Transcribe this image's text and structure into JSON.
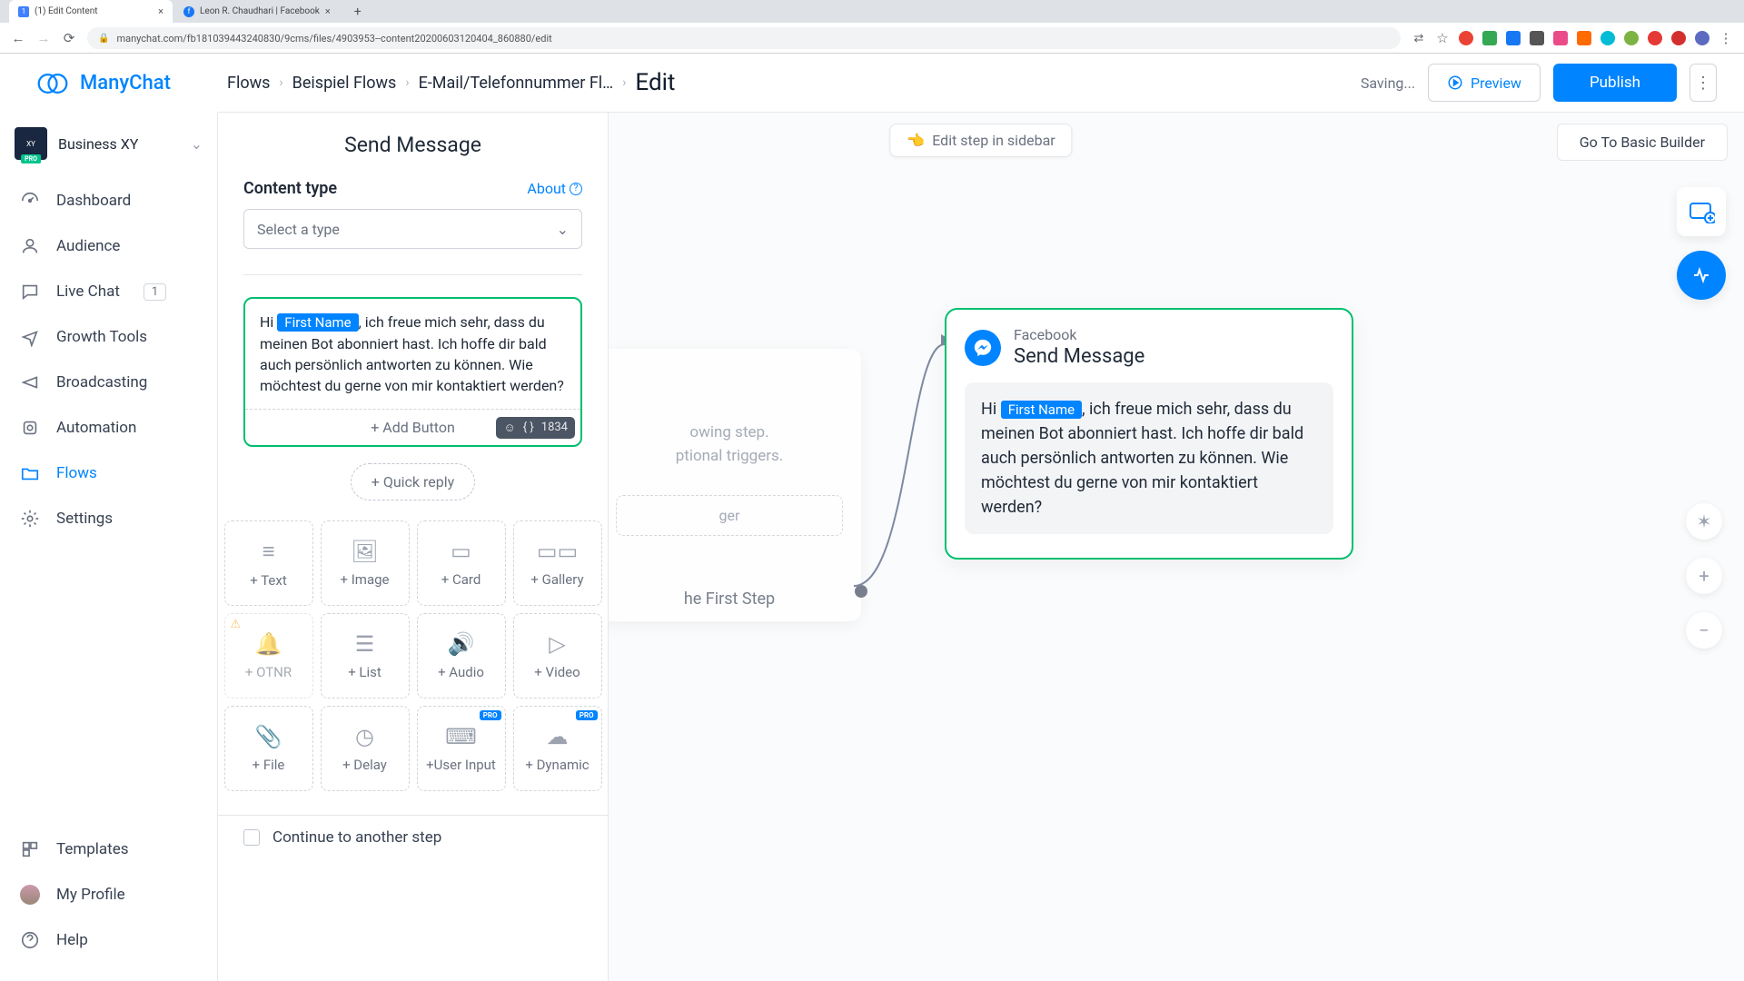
{
  "browser": {
    "tabs": [
      {
        "title": "(1) Edit Content",
        "fav": "1"
      },
      {
        "title": "Leon R. Chaudhari | Facebook",
        "fav": "f"
      }
    ],
    "url": "manychat.com/fb181039443240830/9cms/files/4903953--content20200603120404_860880/edit"
  },
  "app": {
    "logo_text": "ManyChat",
    "breadcrumbs": [
      "Flows",
      "Beispiel Flows",
      "E-Mail/Telefonnummer Fl…",
      "Edit"
    ],
    "saving": "Saving...",
    "preview": "Preview",
    "publish": "Publish"
  },
  "biz": {
    "name": "Business XY",
    "pro": "PRO"
  },
  "nav": {
    "dashboard": "Dashboard",
    "audience": "Audience",
    "livechat": "Live Chat",
    "livechat_badge": "1",
    "growth": "Growth Tools",
    "broadcasting": "Broadcasting",
    "automation": "Automation",
    "flows": "Flows",
    "settings": "Settings",
    "templates": "Templates",
    "profile": "My Profile",
    "help": "Help"
  },
  "canvas": {
    "edit_sidebar": "Edit step in sidebar",
    "basic_builder": "Go To Basic Builder",
    "ghost_line1": "owing step.",
    "ghost_line2": "ptional triggers.",
    "ghost_trigger": "ger",
    "first_step": "he First Step"
  },
  "editor": {
    "title": "Send Message",
    "content_type_label": "Content type",
    "about": "About",
    "select_placeholder": "Select a type",
    "msg_hi": "Hi ",
    "msg_var": "First Name",
    "msg_rest": ", ich freue mich sehr, dass du meinen Bot abonniert hast. Ich hoffe dir bald auch persönlich antworten zu können. Wie möchtest du gerne von mir kontaktiert werden?",
    "add_button": "+ Add Button",
    "char_count": "1834",
    "quick_reply": "+ Quick reply",
    "blocks": {
      "text": "+ Text",
      "image": "+ Image",
      "card": "+ Card",
      "gallery": "+ Gallery",
      "otnr": "+ OTNR",
      "list": "+ List",
      "audio": "+ Audio",
      "video": "+ Video",
      "file": "+ File",
      "delay": "+ Delay",
      "userinput": "+User Input",
      "dynamic": "+ Dynamic"
    },
    "continue": "Continue to another step"
  },
  "fb_node": {
    "sub": "Facebook",
    "title": "Send Message",
    "bubble_hi": "Hi ",
    "bubble_var": "First Name",
    "bubble_rest": ", ich freue mich sehr, dass du meinen Bot abonniert hast. Ich hoffe dir bald auch persönlich antworten zu können. Wie möchtest du gerne von mir kontaktiert werden?"
  }
}
